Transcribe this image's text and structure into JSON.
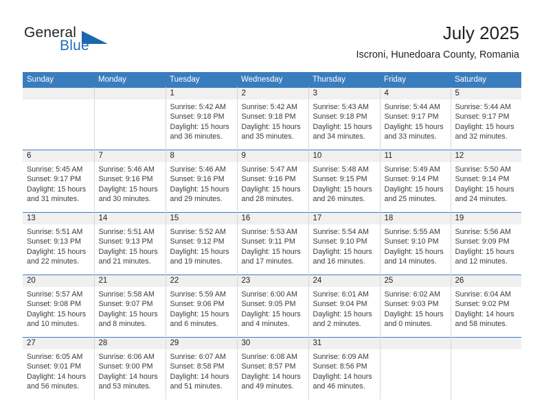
{
  "brand": {
    "name_part1": "General",
    "name_part2": "Blue",
    "triangle_color": "#1a68ae",
    "blue_color": "#1f6fb5"
  },
  "header": {
    "title": "July 2025",
    "subtitle": "Iscroni, Hunedoara County, Romania"
  },
  "calendar": {
    "accent_color": "#3a7dbf",
    "daynum_band_color": "#f0f0f0",
    "weekday_headers": [
      "Sunday",
      "Monday",
      "Tuesday",
      "Wednesday",
      "Thursday",
      "Friday",
      "Saturday"
    ],
    "weeks": [
      [
        {
          "day": "",
          "sunrise": "",
          "sunset": "",
          "daylight1": "",
          "daylight2": ""
        },
        {
          "day": "",
          "sunrise": "",
          "sunset": "",
          "daylight1": "",
          "daylight2": ""
        },
        {
          "day": "1",
          "sunrise": "Sunrise: 5:42 AM",
          "sunset": "Sunset: 9:18 PM",
          "daylight1": "Daylight: 15 hours",
          "daylight2": "and 36 minutes."
        },
        {
          "day": "2",
          "sunrise": "Sunrise: 5:42 AM",
          "sunset": "Sunset: 9:18 PM",
          "daylight1": "Daylight: 15 hours",
          "daylight2": "and 35 minutes."
        },
        {
          "day": "3",
          "sunrise": "Sunrise: 5:43 AM",
          "sunset": "Sunset: 9:18 PM",
          "daylight1": "Daylight: 15 hours",
          "daylight2": "and 34 minutes."
        },
        {
          "day": "4",
          "sunrise": "Sunrise: 5:44 AM",
          "sunset": "Sunset: 9:17 PM",
          "daylight1": "Daylight: 15 hours",
          "daylight2": "and 33 minutes."
        },
        {
          "day": "5",
          "sunrise": "Sunrise: 5:44 AM",
          "sunset": "Sunset: 9:17 PM",
          "daylight1": "Daylight: 15 hours",
          "daylight2": "and 32 minutes."
        }
      ],
      [
        {
          "day": "6",
          "sunrise": "Sunrise: 5:45 AM",
          "sunset": "Sunset: 9:17 PM",
          "daylight1": "Daylight: 15 hours",
          "daylight2": "and 31 minutes."
        },
        {
          "day": "7",
          "sunrise": "Sunrise: 5:46 AM",
          "sunset": "Sunset: 9:16 PM",
          "daylight1": "Daylight: 15 hours",
          "daylight2": "and 30 minutes."
        },
        {
          "day": "8",
          "sunrise": "Sunrise: 5:46 AM",
          "sunset": "Sunset: 9:16 PM",
          "daylight1": "Daylight: 15 hours",
          "daylight2": "and 29 minutes."
        },
        {
          "day": "9",
          "sunrise": "Sunrise: 5:47 AM",
          "sunset": "Sunset: 9:16 PM",
          "daylight1": "Daylight: 15 hours",
          "daylight2": "and 28 minutes."
        },
        {
          "day": "10",
          "sunrise": "Sunrise: 5:48 AM",
          "sunset": "Sunset: 9:15 PM",
          "daylight1": "Daylight: 15 hours",
          "daylight2": "and 26 minutes."
        },
        {
          "day": "11",
          "sunrise": "Sunrise: 5:49 AM",
          "sunset": "Sunset: 9:14 PM",
          "daylight1": "Daylight: 15 hours",
          "daylight2": "and 25 minutes."
        },
        {
          "day": "12",
          "sunrise": "Sunrise: 5:50 AM",
          "sunset": "Sunset: 9:14 PM",
          "daylight1": "Daylight: 15 hours",
          "daylight2": "and 24 minutes."
        }
      ],
      [
        {
          "day": "13",
          "sunrise": "Sunrise: 5:51 AM",
          "sunset": "Sunset: 9:13 PM",
          "daylight1": "Daylight: 15 hours",
          "daylight2": "and 22 minutes."
        },
        {
          "day": "14",
          "sunrise": "Sunrise: 5:51 AM",
          "sunset": "Sunset: 9:13 PM",
          "daylight1": "Daylight: 15 hours",
          "daylight2": "and 21 minutes."
        },
        {
          "day": "15",
          "sunrise": "Sunrise: 5:52 AM",
          "sunset": "Sunset: 9:12 PM",
          "daylight1": "Daylight: 15 hours",
          "daylight2": "and 19 minutes."
        },
        {
          "day": "16",
          "sunrise": "Sunrise: 5:53 AM",
          "sunset": "Sunset: 9:11 PM",
          "daylight1": "Daylight: 15 hours",
          "daylight2": "and 17 minutes."
        },
        {
          "day": "17",
          "sunrise": "Sunrise: 5:54 AM",
          "sunset": "Sunset: 9:10 PM",
          "daylight1": "Daylight: 15 hours",
          "daylight2": "and 16 minutes."
        },
        {
          "day": "18",
          "sunrise": "Sunrise: 5:55 AM",
          "sunset": "Sunset: 9:10 PM",
          "daylight1": "Daylight: 15 hours",
          "daylight2": "and 14 minutes."
        },
        {
          "day": "19",
          "sunrise": "Sunrise: 5:56 AM",
          "sunset": "Sunset: 9:09 PM",
          "daylight1": "Daylight: 15 hours",
          "daylight2": "and 12 minutes."
        }
      ],
      [
        {
          "day": "20",
          "sunrise": "Sunrise: 5:57 AM",
          "sunset": "Sunset: 9:08 PM",
          "daylight1": "Daylight: 15 hours",
          "daylight2": "and 10 minutes."
        },
        {
          "day": "21",
          "sunrise": "Sunrise: 5:58 AM",
          "sunset": "Sunset: 9:07 PM",
          "daylight1": "Daylight: 15 hours",
          "daylight2": "and 8 minutes."
        },
        {
          "day": "22",
          "sunrise": "Sunrise: 5:59 AM",
          "sunset": "Sunset: 9:06 PM",
          "daylight1": "Daylight: 15 hours",
          "daylight2": "and 6 minutes."
        },
        {
          "day": "23",
          "sunrise": "Sunrise: 6:00 AM",
          "sunset": "Sunset: 9:05 PM",
          "daylight1": "Daylight: 15 hours",
          "daylight2": "and 4 minutes."
        },
        {
          "day": "24",
          "sunrise": "Sunrise: 6:01 AM",
          "sunset": "Sunset: 9:04 PM",
          "daylight1": "Daylight: 15 hours",
          "daylight2": "and 2 minutes."
        },
        {
          "day": "25",
          "sunrise": "Sunrise: 6:02 AM",
          "sunset": "Sunset: 9:03 PM",
          "daylight1": "Daylight: 15 hours",
          "daylight2": "and 0 minutes."
        },
        {
          "day": "26",
          "sunrise": "Sunrise: 6:04 AM",
          "sunset": "Sunset: 9:02 PM",
          "daylight1": "Daylight: 14 hours",
          "daylight2": "and 58 minutes."
        }
      ],
      [
        {
          "day": "27",
          "sunrise": "Sunrise: 6:05 AM",
          "sunset": "Sunset: 9:01 PM",
          "daylight1": "Daylight: 14 hours",
          "daylight2": "and 56 minutes."
        },
        {
          "day": "28",
          "sunrise": "Sunrise: 6:06 AM",
          "sunset": "Sunset: 9:00 PM",
          "daylight1": "Daylight: 14 hours",
          "daylight2": "and 53 minutes."
        },
        {
          "day": "29",
          "sunrise": "Sunrise: 6:07 AM",
          "sunset": "Sunset: 8:58 PM",
          "daylight1": "Daylight: 14 hours",
          "daylight2": "and 51 minutes."
        },
        {
          "day": "30",
          "sunrise": "Sunrise: 6:08 AM",
          "sunset": "Sunset: 8:57 PM",
          "daylight1": "Daylight: 14 hours",
          "daylight2": "and 49 minutes."
        },
        {
          "day": "31",
          "sunrise": "Sunrise: 6:09 AM",
          "sunset": "Sunset: 8:56 PM",
          "daylight1": "Daylight: 14 hours",
          "daylight2": "and 46 minutes."
        },
        {
          "day": "",
          "sunrise": "",
          "sunset": "",
          "daylight1": "",
          "daylight2": ""
        },
        {
          "day": "",
          "sunrise": "",
          "sunset": "",
          "daylight1": "",
          "daylight2": ""
        }
      ]
    ]
  }
}
